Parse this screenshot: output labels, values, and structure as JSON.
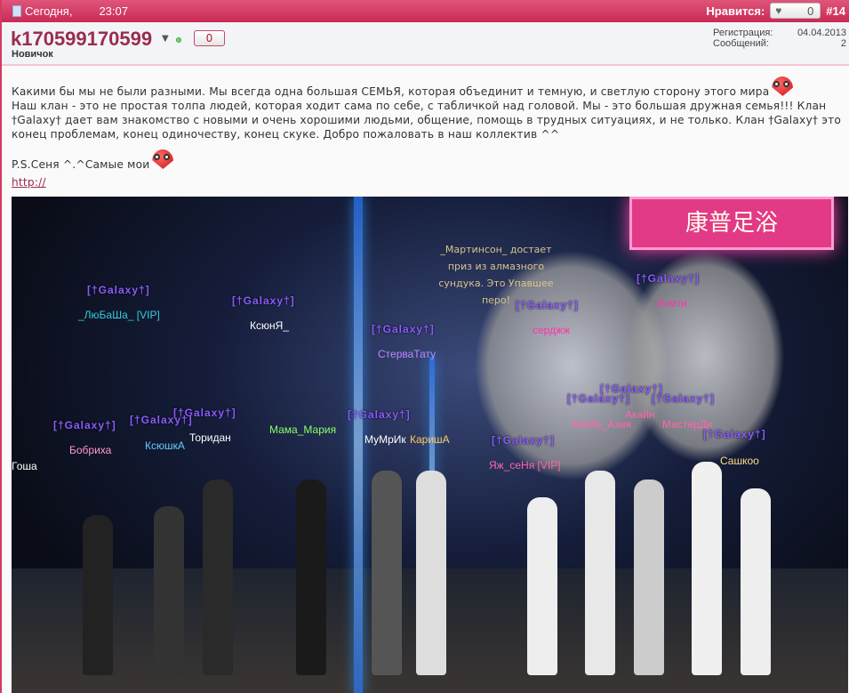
{
  "header": {
    "date": "Сегодня,",
    "time": "23:07",
    "like_label": "Нравится:",
    "like_count": "0",
    "post_number": "#14"
  },
  "user": {
    "name": "k170599170599",
    "rank": "Новичок",
    "reputation": "0",
    "reg_label": "Регистрация:",
    "reg_date": "04.04.2013",
    "posts_label": "Сообщений:",
    "posts_count": "2"
  },
  "post": {
    "line1": "Какими бы мы не были разными. Мы всегда одна большая СЕМЬЯ, которая объединит и темную, и светлую сторону этого мира",
    "line2": "Наш клан - это не простая толпа людей, которая ходит сама по себе, с табличкой над головой. Мы - это большая дружная семья!!! Клан †Galaxy† дает вам знакомство с новыми и очень хорошими людьми, общение, помощь в трудных ситуациях, и не только. Клан †Galaxy† это конец проблемам, конец одиночеству, конец скуке. Добро пожаловать в наш коллектив ^^",
    "ps": "P.S.Сеня ^.^Самые мои",
    "link": "http://"
  },
  "screenshot": {
    "sign": "康普足浴",
    "message": "_Мартинсон_ достает приз из алмазного сундука. Это Упавшее перо!",
    "clan_tag": "[†Galaxy†]",
    "names": [
      "_ЛюБаШа_ [VIP]",
      "КсюнЯ_",
      "СтерваТату",
      "серджж",
      "Ломти",
      "Мама_Мария",
      "Торидан",
      "КсюшкА",
      "Бобриха",
      "Гоша",
      "МуМрИк",
      "КаришА",
      "Яж_сеНя [VIP]",
      "МаМа_Азия",
      "Акайн",
      "МастерДи",
      "Сашкоо"
    ]
  }
}
